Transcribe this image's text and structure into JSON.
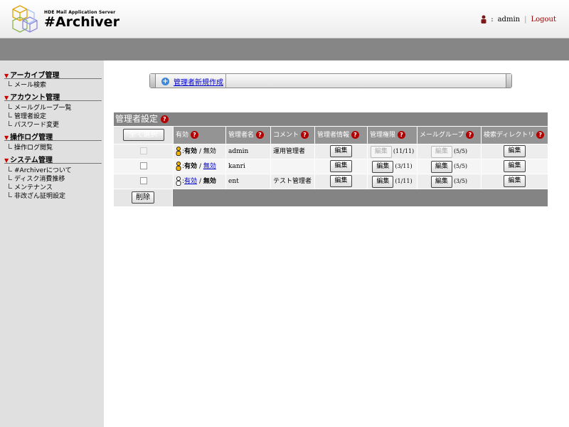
{
  "header": {
    "product_sub": "HDE Mail Application Server",
    "product_name": "#Archiver",
    "user_icon": "user-icon",
    "user_separator": ":",
    "username": "admin",
    "divider": "|",
    "logout": "Logout"
  },
  "sidebar": {
    "sections": [
      {
        "title": "アーカイブ管理",
        "items": [
          "メール検索"
        ]
      },
      {
        "title": "アカウント管理",
        "items": [
          "メールグループ一覧",
          "管理者設定",
          "パスワード変更"
        ]
      },
      {
        "title": "操作ログ管理",
        "items": [
          "操作ログ閲覧"
        ]
      },
      {
        "title": "システム管理",
        "items": [
          "#Archiverについて",
          "ディスク消費推移",
          "メンテナンス",
          "非改ざん証明設定"
        ]
      }
    ]
  },
  "toolbar": {
    "new_admin": "管理者新規作成",
    "icon": "plus-icon"
  },
  "panel": {
    "title": "管理者設定",
    "select_all": "全て選択",
    "delete": "削除",
    "columns": [
      "有効",
      "管理者名",
      "コメント",
      "管理者情報",
      "管理権限",
      "メールグループ",
      "検索ディレクトリ"
    ],
    "enabled_label": "有効",
    "disabled_label": "無効",
    "slash": "/",
    "colon": ":",
    "edit_label": "編集",
    "rows": [
      {
        "status": "有効",
        "name": "admin",
        "comment": "運用管理者",
        "perm_count": "(11/11)",
        "group_count": "(5/5)"
      },
      {
        "status": "有効",
        "name": "kanri",
        "comment": "",
        "perm_count": "(3/11)",
        "group_count": "(5/5)"
      },
      {
        "status": "無効",
        "name": "ent",
        "comment": "テスト管理者",
        "perm_count": "(1/11)",
        "group_count": "(3/5)"
      }
    ]
  },
  "colors": {
    "accent_red": "#b20000",
    "band": "#868686",
    "link": "#0000cc"
  }
}
